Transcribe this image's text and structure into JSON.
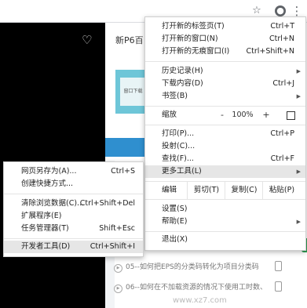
{
  "toolbar": {
    "star_icon": "☆",
    "avatar_icon": "●",
    "more_icon": "⋮"
  },
  "page": {
    "title": "新P6百",
    "banner_text": "窗口下载",
    "list": [
      "05--如何把EPS的分类码转化为项目分类码",
      "06--如何在不加载资源的情况下使用工时数、"
    ],
    "watermark": "www.xz7.com"
  },
  "main_menu": {
    "new_tab": {
      "label": "打开新的标签页(T)",
      "shortcut": "Ctrl+T"
    },
    "new_window": {
      "label": "打开新的窗口(N)",
      "shortcut": "Ctrl+N"
    },
    "incognito": {
      "label": "打开新的无痕窗口(I)",
      "shortcut": "Ctrl+Shift+N"
    },
    "history": {
      "label": "历史记录(H)"
    },
    "downloads": {
      "label": "下载内容(D)",
      "shortcut": "Ctrl+J"
    },
    "bookmarks": {
      "label": "书签(B)"
    },
    "zoom": {
      "label": "缩放",
      "minus": "-",
      "value": "100%",
      "plus": "+"
    },
    "print": {
      "label": "打印(P)...",
      "shortcut": "Ctrl+P"
    },
    "cast": {
      "label": "投射(C)..."
    },
    "find": {
      "label": "查找(F)...",
      "shortcut": "Ctrl+F"
    },
    "more_tools": {
      "label": "更多工具(L)"
    },
    "edit": {
      "label": "编辑",
      "cut": "剪切(T)",
      "copy": "复制(C)",
      "paste": "粘贴(P)"
    },
    "settings": {
      "label": "设置(S)"
    },
    "help": {
      "label": "帮助(E)"
    },
    "exit": {
      "label": "退出(X)"
    }
  },
  "sub_menu": {
    "save_as": {
      "label": "网页另存为(A)...",
      "shortcut": "Ctrl+S"
    },
    "shortcut": {
      "label": "创建快捷方式..."
    },
    "clear_data": {
      "label": "清除浏览数据(C)...",
      "shortcut": "Ctrl+Shift+Del"
    },
    "extensions": {
      "label": "扩展程序(E)"
    },
    "task_manager": {
      "label": "任务管理器(T)",
      "shortcut": "Shift+Esc"
    },
    "devtools": {
      "label": "开发者工具(D)",
      "shortcut": "Ctrl+Shift+I"
    }
  }
}
